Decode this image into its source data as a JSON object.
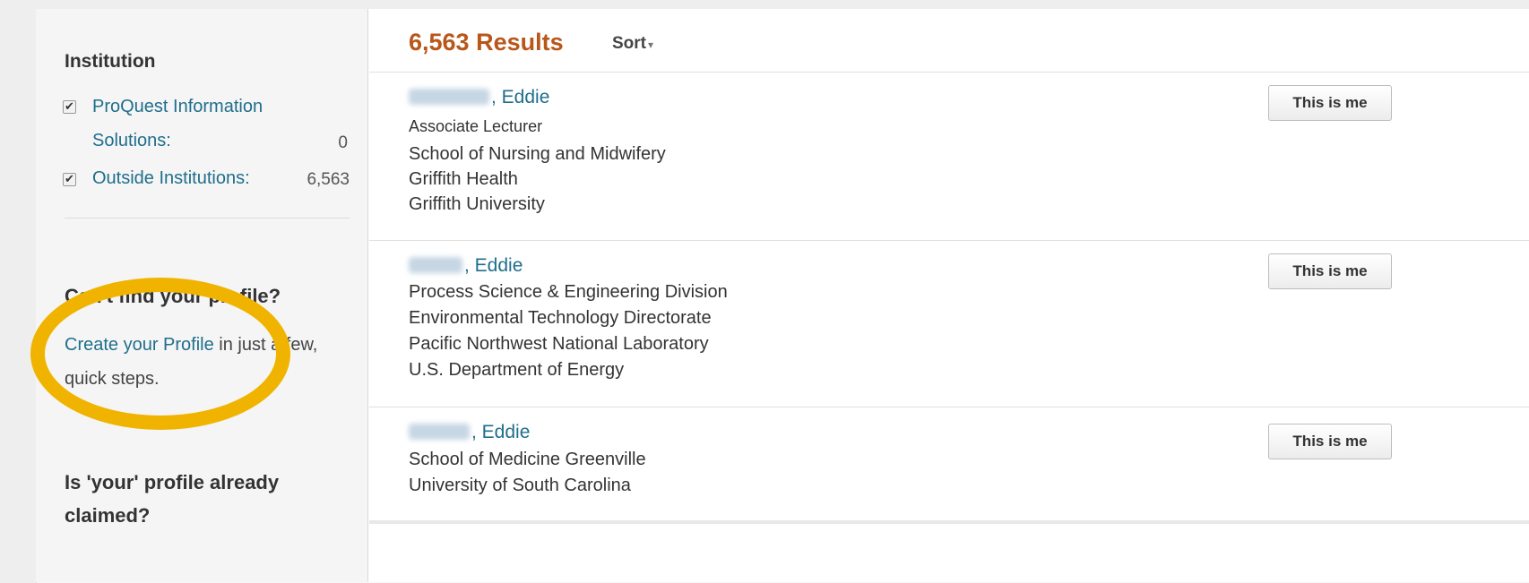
{
  "sidebar": {
    "institution_title": "Institution",
    "facets": [
      {
        "label_line1": "ProQuest Information",
        "label_line2": "Solutions:",
        "count": "0",
        "checked": true
      },
      {
        "label": "Outside Institutions:",
        "count": "6,563",
        "checked": true
      }
    ],
    "cant_find_title": "Can't find your profile?",
    "create_link": "Create your Profile",
    "create_rest_1": " in just a few,",
    "create_rest_2": "quick steps.",
    "claimed_title_1": "Is 'your' profile already",
    "claimed_title_2": "claimed?"
  },
  "results": {
    "count_label": "6,563 Results",
    "sort_label": "Sort",
    "button_label": "This is me",
    "items": [
      {
        "name": ", Eddie",
        "lines": [
          "Associate Lecturer",
          "School of Nursing and Midwifery",
          "Griffith Health",
          "Griffith University"
        ]
      },
      {
        "name": ", Eddie",
        "lines": [
          "Process Science & Engineering Division",
          "Environmental Technology Directorate",
          "Pacific Northwest National Laboratory",
          "U.S. Department of Energy"
        ]
      },
      {
        "name": ", Eddie",
        "lines": [
          "School of Medicine Greenville",
          "University of South Carolina"
        ]
      }
    ]
  },
  "colors": {
    "accent_link": "#1f6e8c",
    "results_count": "#b9561a",
    "highlight": "#f0b400"
  }
}
